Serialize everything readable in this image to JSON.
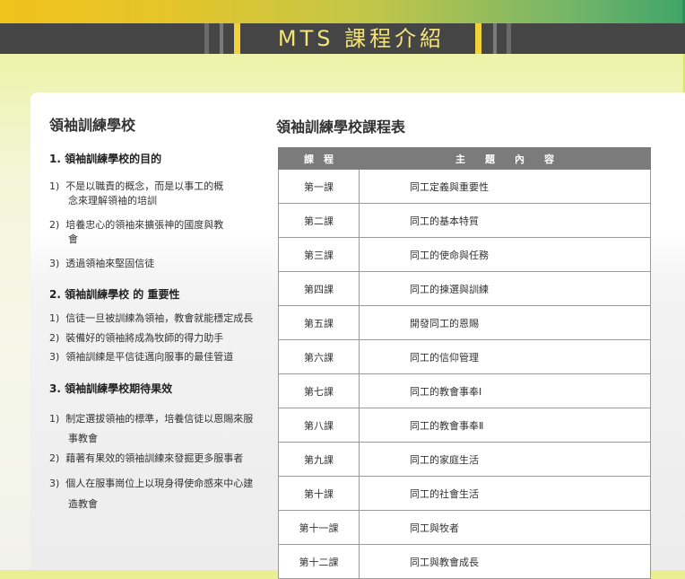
{
  "header": {
    "title": "MTS 課程介紹"
  },
  "left": {
    "heading": "領袖訓練學校",
    "sections": [
      {
        "title": "1.  領袖訓練學校的目的",
        "items": [
          {
            "num": "1)",
            "line1": "不是以職責的概念，而是以事工的概",
            "line2": "念來理解領袖的培訓"
          },
          {
            "num": "2)",
            "line1": "培養忠心的領袖來擴張神的國度與教",
            "line2": "會"
          },
          {
            "num": "3)",
            "line1": "透過領袖來堅固信徒",
            "line2": ""
          }
        ]
      },
      {
        "title": "2.  領袖訓練學校 的 重要性",
        "items": [
          {
            "num": "1)",
            "line1": "信徒一旦被訓練為領袖，教會就能穩定成長",
            "line2": ""
          },
          {
            "num": "2)",
            "line1": "裝備好的領袖將成為牧師的得力助手",
            "line2": ""
          },
          {
            "num": "3)",
            "line1": "領袖訓練是平信徒邁向服事的最佳管道",
            "line2": ""
          }
        ]
      },
      {
        "title": "3.  領袖訓練學校期待果效",
        "items": [
          {
            "num": "1)",
            "line1": "制定選拔領袖的標準，培養信徒以恩賜來服",
            "line2": "事教會"
          },
          {
            "num": "2)",
            "line1": "藉著有果效的領袖訓練來發掘更多服事者",
            "line2": ""
          },
          {
            "num": "3)",
            "line1": "個人在服事崗位上以現身得使命感來中心建",
            "line2": "造教會"
          }
        ]
      }
    ]
  },
  "right": {
    "heading": "領袖訓練學校課程表",
    "table": {
      "headers": [
        "課　程",
        "主　　題　　內　　容"
      ],
      "rows": [
        {
          "lesson": "第一課",
          "topic": "同工定義與重要性"
        },
        {
          "lesson": "第二課",
          "topic": "同工的基本特質"
        },
        {
          "lesson": "第三課",
          "topic": "同工的使命與任務"
        },
        {
          "lesson": "第四課",
          "topic": "同工的揀選與訓練"
        },
        {
          "lesson": "第五課",
          "topic": "開發同工的恩賜"
        },
        {
          "lesson": "第六課",
          "topic": "同工的信仰管理"
        },
        {
          "lesson": "第七課",
          "topic": "同工的教會事奉Ⅰ"
        },
        {
          "lesson": "第八課",
          "topic": "同工的教會事奉Ⅱ"
        },
        {
          "lesson": "第九課",
          "topic": "同工的家庭生活"
        },
        {
          "lesson": "第十課",
          "topic": "同工的社會生活"
        },
        {
          "lesson": "第十一課",
          "topic": "同工與牧者"
        },
        {
          "lesson": "第十二課",
          "topic": "同工與教會成長"
        }
      ]
    }
  }
}
